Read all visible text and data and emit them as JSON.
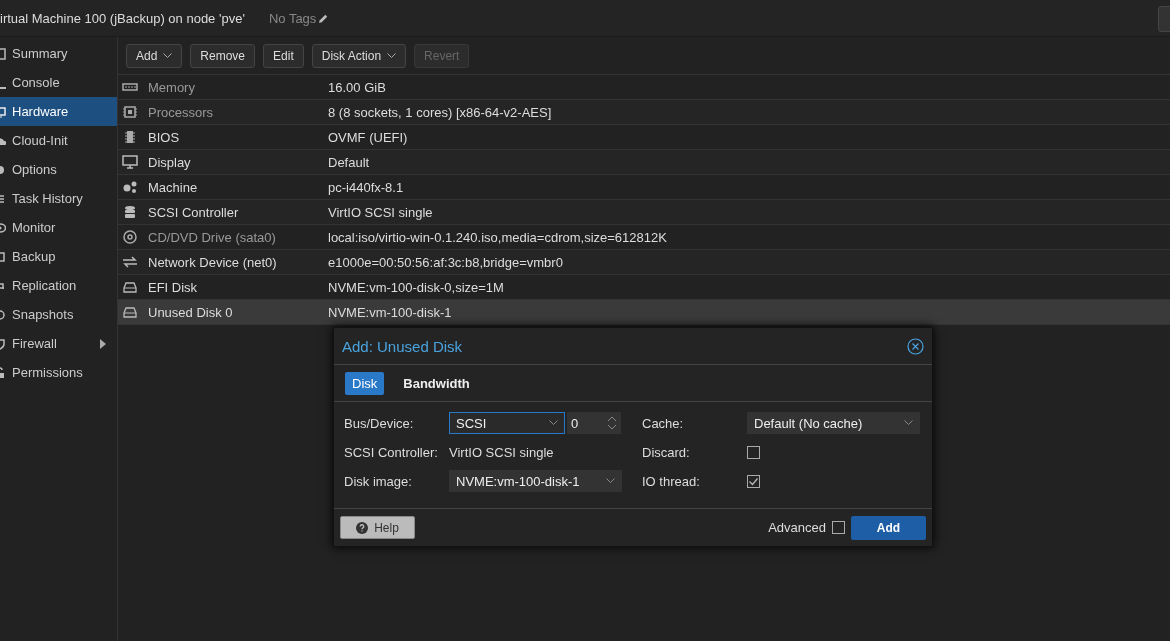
{
  "header": {
    "title": "irtual Machine 100 (jBackup) on node 'pve'",
    "tags": "No Tags"
  },
  "sidebar": {
    "items": [
      {
        "label": "Summary",
        "selected": false,
        "expandable": false
      },
      {
        "label": "Console",
        "selected": false,
        "expandable": false
      },
      {
        "label": "Hardware",
        "selected": true,
        "expandable": false
      },
      {
        "label": "Cloud-Init",
        "selected": false,
        "expandable": false
      },
      {
        "label": "Options",
        "selected": false,
        "expandable": false
      },
      {
        "label": "Task History",
        "selected": false,
        "expandable": false
      },
      {
        "label": "Monitor",
        "selected": false,
        "expandable": false
      },
      {
        "label": "Backup",
        "selected": false,
        "expandable": false
      },
      {
        "label": "Replication",
        "selected": false,
        "expandable": false
      },
      {
        "label": "Snapshots",
        "selected": false,
        "expandable": false
      },
      {
        "label": "Firewall",
        "selected": false,
        "expandable": true
      },
      {
        "label": "Permissions",
        "selected": false,
        "expandable": false
      }
    ]
  },
  "toolbar": {
    "buttons": [
      {
        "label": "Add",
        "dropdown": true,
        "disabled": false
      },
      {
        "label": "Remove",
        "dropdown": false,
        "disabled": false
      },
      {
        "label": "Edit",
        "dropdown": false,
        "disabled": false
      },
      {
        "label": "Disk Action",
        "dropdown": true,
        "disabled": false
      },
      {
        "label": "Revert",
        "dropdown": false,
        "disabled": true
      }
    ]
  },
  "hardware": {
    "rows": [
      {
        "kind": "memory",
        "name": "Memory",
        "value": "16.00 GiB",
        "dimmed": true,
        "selected": false
      },
      {
        "kind": "cpu",
        "name": "Processors",
        "value": "8 (8 sockets, 1 cores) [x86-64-v2-AES]",
        "dimmed": true,
        "selected": false
      },
      {
        "kind": "chip",
        "name": "BIOS",
        "value": "OVMF (UEFI)",
        "dimmed": false,
        "selected": false
      },
      {
        "kind": "display",
        "name": "Display",
        "value": "Default",
        "dimmed": false,
        "selected": false
      },
      {
        "kind": "gears",
        "name": "Machine",
        "value": "pc-i440fx-8.1",
        "dimmed": false,
        "selected": false
      },
      {
        "kind": "database",
        "name": "SCSI Controller",
        "value": "VirtIO SCSI single",
        "dimmed": false,
        "selected": false
      },
      {
        "kind": "disc",
        "name": "CD/DVD Drive (sata0)",
        "value": "local:iso/virtio-win-0.1.240.iso,media=cdrom,size=612812K",
        "dimmed": true,
        "selected": false
      },
      {
        "kind": "network",
        "name": "Network Device (net0)",
        "value": "e1000e=00:50:56:af:3c:b8,bridge=vmbr0",
        "dimmed": false,
        "selected": false
      },
      {
        "kind": "disk",
        "name": "EFI Disk",
        "value": "NVME:vm-100-disk-0,size=1M",
        "dimmed": false,
        "selected": false
      },
      {
        "kind": "disk",
        "name": "Unused Disk 0",
        "value": "NVME:vm-100-disk-1",
        "dimmed": false,
        "selected": true
      }
    ]
  },
  "dialog": {
    "title": "Add: Unused Disk",
    "tabs": [
      {
        "label": "Disk",
        "selected": true
      },
      {
        "label": "Bandwidth",
        "selected": false
      }
    ],
    "left": [
      {
        "kind": "busdevice",
        "label": "Bus/Device:",
        "value": "SCSI",
        "number": "0",
        "focused": true
      },
      {
        "kind": "text",
        "label": "SCSI Controller:",
        "value": "VirtIO SCSI single"
      },
      {
        "kind": "select",
        "label": "Disk image:",
        "value": "NVME:vm-100-disk-1",
        "focused": false
      }
    ],
    "right": [
      {
        "kind": "select",
        "label": "Cache:",
        "value": "Default (No cache)",
        "focused": false
      },
      {
        "kind": "checkbox",
        "label": "Discard:",
        "checked": false
      },
      {
        "kind": "checkbox",
        "label": "IO thread:",
        "checked": true
      }
    ],
    "help": "Help",
    "advanced": {
      "label": "Advanced",
      "checked": false
    },
    "submit": "Add"
  }
}
